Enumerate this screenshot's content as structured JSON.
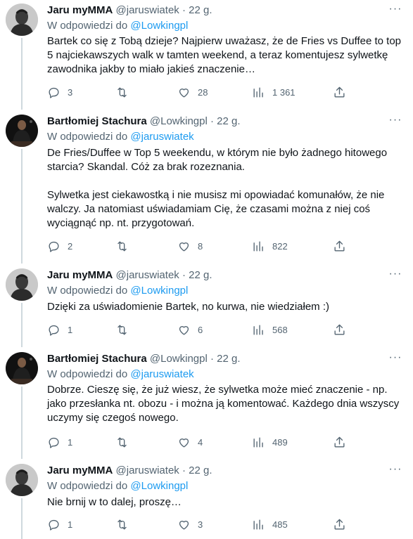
{
  "tweets": [
    {
      "name": "Jaru myMMA",
      "handle": "@jaruswiatek",
      "dot": "·",
      "time": "22 g.",
      "reply_prefix": "W odpowiedzi do",
      "reply_to": "@Lowkingpl",
      "paragraphs": [
        "Bartek co się z Tobą dzieje? Najpierw uważasz, że de Fries vs Duffee to top 5 najciekawszych walk w tamten weekend, a teraz komentujesz sylwetkę zawodnika jakby to miało jakieś znaczenie…"
      ],
      "replies": "3",
      "retweets": "",
      "likes": "28",
      "views": "1 361"
    },
    {
      "name": "Bartłomiej Stachura",
      "handle": "@Lowkingpl",
      "dot": "·",
      "time": "22 g.",
      "reply_prefix": "W odpowiedzi do",
      "reply_to": "@jaruswiatek",
      "paragraphs": [
        "De Fries/Duffee w Top 5 weekendu, w którym nie było żadnego hitowego starcia? Skandal. Cóż za brak rozeznania.",
        "Sylwetka jest ciekawostką i nie musisz mi opowiadać komunałów, że nie walczy. Ja natomiast uświadamiam Cię, że czasami można z niej coś wyciągnąć np. nt. przygotowań."
      ],
      "replies": "2",
      "retweets": "",
      "likes": "8",
      "views": "822"
    },
    {
      "name": "Jaru myMMA",
      "handle": "@jaruswiatek",
      "dot": "·",
      "time": "22 g.",
      "reply_prefix": "W odpowiedzi do",
      "reply_to": "@Lowkingpl",
      "paragraphs": [
        "Dzięki za uświadomienie Bartek, no kurwa, nie wiedziałem :)"
      ],
      "replies": "1",
      "retweets": "",
      "likes": "6",
      "views": "568"
    },
    {
      "name": "Bartłomiej Stachura",
      "handle": "@Lowkingpl",
      "dot": "·",
      "time": "22 g.",
      "reply_prefix": "W odpowiedzi do",
      "reply_to": "@jaruswiatek",
      "paragraphs": [
        "Dobrze. Cieszę się, że już wiesz, że sylwetka może mieć znaczenie - np. jako przesłanka nt. obozu - i można ją komentować. Każdego dnia wszyscy uczymy się czegoś nowego."
      ],
      "replies": "1",
      "retweets": "",
      "likes": "4",
      "views": "489"
    },
    {
      "name": "Jaru myMMA",
      "handle": "@jaruswiatek",
      "dot": "·",
      "time": "22 g.",
      "reply_prefix": "W odpowiedzi do",
      "reply_to": "@Lowkingpl",
      "paragraphs": [
        "Nie brnij w to dalej, proszę…"
      ],
      "replies": "1",
      "retweets": "",
      "likes": "3",
      "views": "485"
    }
  ],
  "more_icon": "···",
  "colors": {
    "link": "#1d9bf0",
    "muted": "#536471",
    "text": "#0f1419",
    "thread_line": "#cfd9de",
    "separator": "#eff3f4"
  },
  "icons": [
    "reply-icon",
    "retweet-icon",
    "like-icon",
    "views-icon",
    "share-icon",
    "more-icon"
  ]
}
